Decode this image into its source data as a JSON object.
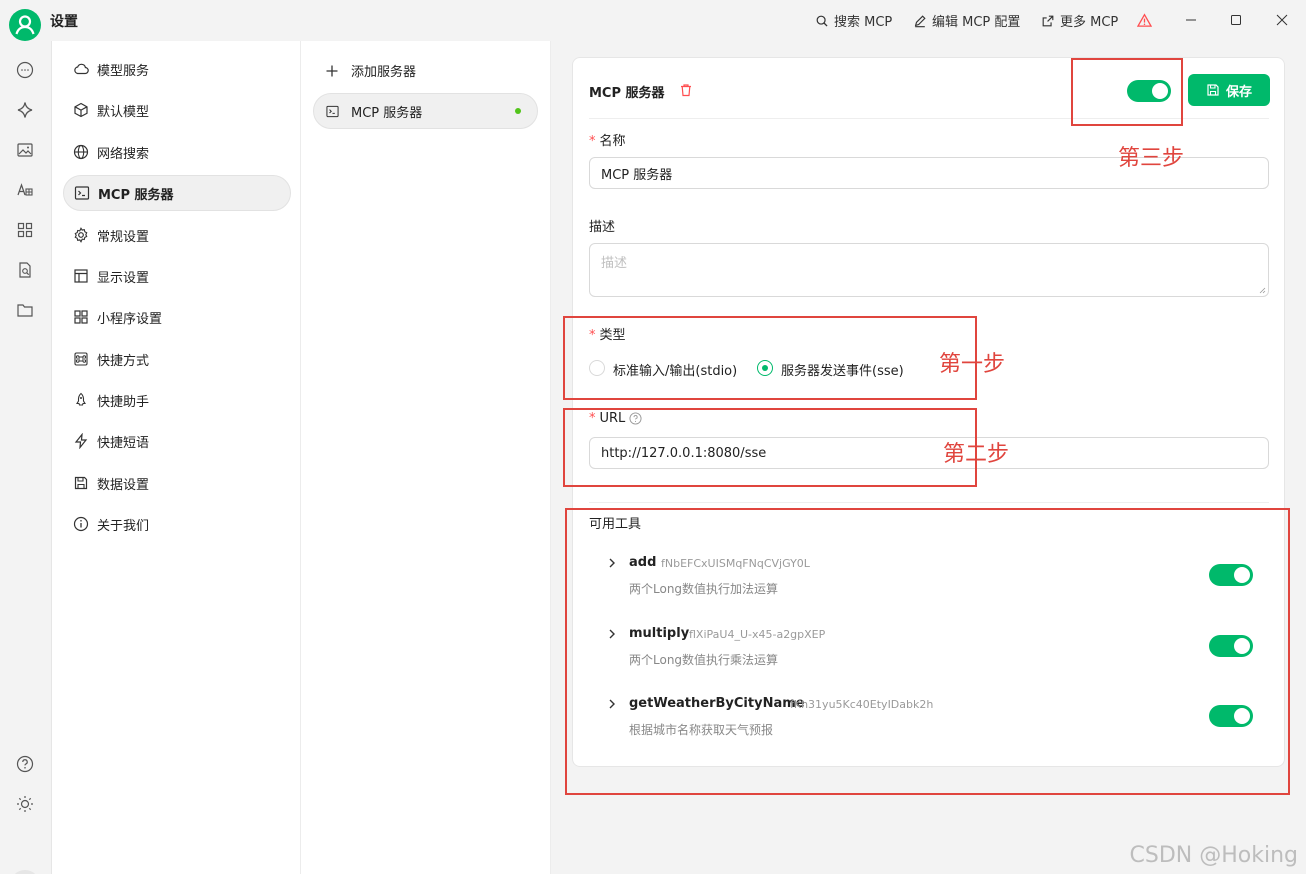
{
  "window": {
    "title": "设置",
    "actions": [
      {
        "label": "搜索 MCP",
        "icon": "search-icon"
      },
      {
        "label": "编辑 MCP 配置",
        "icon": "pencil-icon"
      },
      {
        "label": "更多 MCP",
        "icon": "external-link-icon"
      }
    ]
  },
  "nav": {
    "items": [
      {
        "label": "模型服务",
        "icon": "cloud-icon"
      },
      {
        "label": "默认模型",
        "icon": "cube-icon"
      },
      {
        "label": "网络搜索",
        "icon": "globe-icon"
      },
      {
        "label": "MCP 服务器",
        "icon": "terminal-icon",
        "active": true
      },
      {
        "label": "常规设置",
        "icon": "gear-icon"
      },
      {
        "label": "显示设置",
        "icon": "layout-icon"
      },
      {
        "label": "小程序设置",
        "icon": "grid-icon"
      },
      {
        "label": "快捷方式",
        "icon": "command-icon"
      },
      {
        "label": "快捷助手",
        "icon": "rocket-icon"
      },
      {
        "label": "快捷短语",
        "icon": "zap-icon"
      },
      {
        "label": "数据设置",
        "icon": "save-icon"
      },
      {
        "label": "关于我们",
        "icon": "info-icon"
      }
    ]
  },
  "servers": {
    "add_label": "添加服务器",
    "items": [
      {
        "label": "MCP 服务器",
        "active": true,
        "status_color": "#52c41a"
      }
    ]
  },
  "detail": {
    "header_title": "MCP 服务器",
    "enabled": true,
    "save_label": "保存",
    "name_label": "名称",
    "name_value": "MCP 服务器",
    "desc_label": "描述",
    "desc_placeholder": "描述",
    "type_label": "类型",
    "type_options": [
      "标准输入/输出(stdio)",
      "服务器发送事件(sse)"
    ],
    "type_selected": "服务器发送事件(sse)",
    "url_label": "URL",
    "url_value": "http://127.0.0.1:8080/sse",
    "tools_label": "可用工具",
    "tools": [
      {
        "name": "add",
        "id": "fNbEFCxUISMqFNqCVjGY0L",
        "desc": "两个Long数值执行加法运算",
        "enabled": true
      },
      {
        "name": "multiply",
        "id": "flXiPaU4_U-x45-a2gpXEP",
        "desc": "两个Long数值执行乘法运算",
        "enabled": true
      },
      {
        "name": "getWeatherByCityName",
        "id": "fKh31yu5Kc40EtyIDabk2h",
        "desc": "根据城市名称获取天气预报",
        "enabled": true
      }
    ]
  },
  "annotations": {
    "step1": "第一步",
    "step2": "第二步",
    "step3": "第三步",
    "color": "#e0453e"
  },
  "watermark": "CSDN @Hoking",
  "accent_color": "#00b96b"
}
